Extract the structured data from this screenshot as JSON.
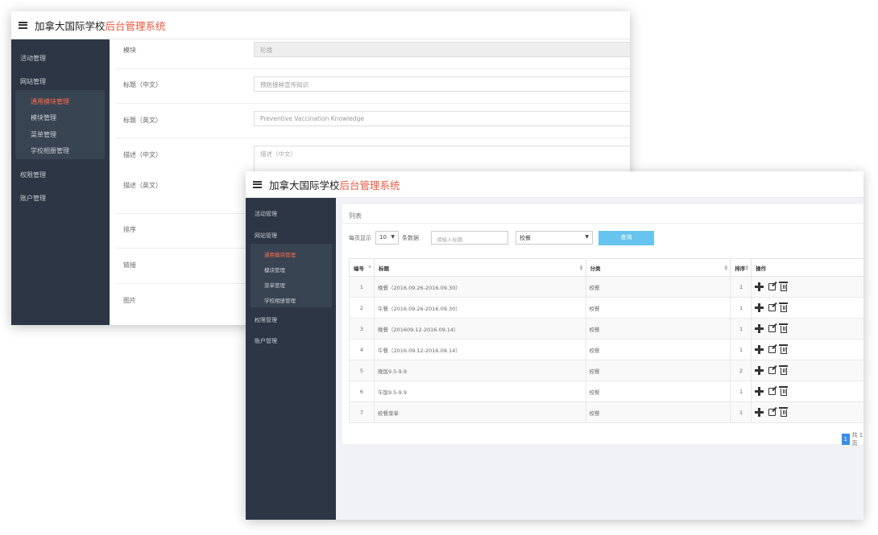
{
  "app": {
    "brand_main": "加拿大国际学校",
    "brand_sub": "后台管理系统"
  },
  "sidebar": {
    "items": [
      "活动管理",
      "网站管理",
      "权限管理",
      "账户管理"
    ],
    "sub_items": [
      "通用模块管理",
      "模块管理",
      "菜单管理",
      "学校相册管理"
    ],
    "active_sub": "通用模块管理"
  },
  "form": {
    "module_label": "模块",
    "module_value": "轮播",
    "title_cn_label": "标题（中文）",
    "title_cn_value": "预防接种宣传知识",
    "title_en_label": "标题（英文）",
    "title_en_value": "Preventive Vaccination Knowledge",
    "desc_cn_label": "描述（中文）",
    "desc_cn_placeholder": "描述（中文）",
    "desc_en_label": "描述（英文）",
    "sort_label": "排序",
    "link_label": "链接",
    "image_label": "图片"
  },
  "list": {
    "title": "列表",
    "per_page_prefix": "每页显示",
    "per_page_value": "10",
    "per_page_suffix": "条数据",
    "search_placeholder": "请输入标题",
    "category_value": "校餐",
    "query_button": "查询",
    "columns": [
      "编号",
      "标题",
      "分类",
      "排序",
      "操作"
    ],
    "rows": [
      {
        "id": "1",
        "title": "晚餐（2016.09.26-2016.09.30）",
        "category": "校餐",
        "sort": "1"
      },
      {
        "id": "2",
        "title": "午餐（2016.09.26-2016.09.30）",
        "category": "校餐",
        "sort": "1"
      },
      {
        "id": "3",
        "title": "晚餐（201609.12-2016.09.14）",
        "category": "校餐",
        "sort": "1"
      },
      {
        "id": "4",
        "title": "午餐（2016.09.12-2016.09.14）",
        "category": "校餐",
        "sort": "1"
      },
      {
        "id": "5",
        "title": "晚饭9.5-9.9",
        "category": "校餐",
        "sort": "2"
      },
      {
        "id": "6",
        "title": "午饭9.5-9.9",
        "category": "校餐",
        "sort": "1"
      },
      {
        "id": "7",
        "title": "校餐菜单",
        "category": "校餐",
        "sort": "1"
      }
    ],
    "pager": {
      "current": "1",
      "total_text": "共 1 页"
    }
  },
  "icons": {
    "menu": "hamburger-icon",
    "add": "plus-icon",
    "edit": "edit-icon",
    "delete": "trash-icon",
    "caret": "caret-down-icon"
  }
}
